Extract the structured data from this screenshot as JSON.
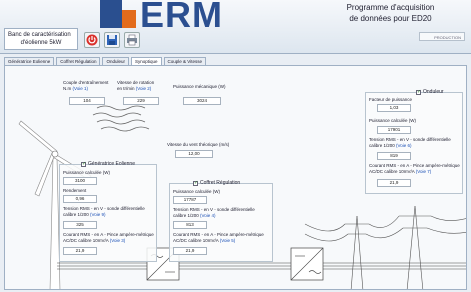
{
  "header": {
    "logo_text": "ERM",
    "app_title_line1": "Programme d'acquisition",
    "app_title_line2": "de données pour ED20",
    "left_title_line1": "Banc de caractérisation",
    "left_title_line2": "d'éolienne 5kW",
    "right_tag": "PRODUCTION"
  },
  "tabs": [
    {
      "label": "Génératrice Eolienne"
    },
    {
      "label": "Coffret Régulation"
    },
    {
      "label": "Onduleur"
    },
    {
      "label": "Synoptique"
    },
    {
      "label": "Couple & Vitesse"
    }
  ],
  "top": {
    "couple_label": "Couple d'entraînement",
    "couple_unit": "N.m",
    "couple_link": "(Voie 1)",
    "couple_value": "104",
    "vitesse_label": "Vitesse de rotation",
    "vitesse_unit": "en tr/min",
    "vitesse_link": "(Voie 2)",
    "vitesse_value": "229",
    "puissance_meca_label": "Puissance mécanique (W)",
    "puissance_meca_value": "3024",
    "vent_label": "Vitesse du vent théorique (m/s)",
    "vent_value": "12,00"
  },
  "generatrice": {
    "title": "Génératrice Eolienne",
    "puissance_label": "Puissance calculée (W)",
    "puissance_value": "3100",
    "rendement_label": "Rendement",
    "rendement_value": "0,96",
    "tension_label": "Tension RMS - en V - sonde différentielle calibre 1/200",
    "tension_link": "(Voie 9)",
    "tension_value": "325",
    "courant_label": "Courant RMS - en A - Pince ampère-métrique AC/DC calibre 10mV/A",
    "courant_link": "(Voie 3)",
    "courant_value": "21,9"
  },
  "coffret": {
    "title": "Coffret Régulation",
    "puissance_label": "Puissance calculée (W)",
    "puissance_value": "17787",
    "tension_label": "Tension RMS - en V - sonde différentielle calibre 1/200",
    "tension_link": "(Voie 4)",
    "tension_value": "813",
    "courant_label": "Courant RMS - en A - Pince ampère-métrique AC/DC calibre 10mV/A",
    "courant_link": "(Voie 5)",
    "courant_value": "21,9"
  },
  "onduleur": {
    "title": "Onduleur",
    "facteur_label": "Facteur de puissance",
    "facteur_value": "1,03",
    "puissance_label": "Puissance calculée (W)",
    "puissance_value": "17901",
    "tension_label": "Tension RMS - en V - sonde différentielle calibre 1/200",
    "tension_link": "(Voie 6)",
    "tension_value": "819",
    "courant_label": "Courant RMS - en A - Pince ampère-métrique AC/DC calibre 10mV/A",
    "courant_link": "(Voie 7)",
    "courant_value": "21,9"
  },
  "icons": {
    "power": "power-icon",
    "save": "save-icon",
    "print": "print-icon"
  },
  "colors": {
    "brand_blue": "#2b4f90",
    "brand_orange": "#e26b1c",
    "link_blue": "#1a4fb5",
    "power_red": "#d9302a"
  }
}
